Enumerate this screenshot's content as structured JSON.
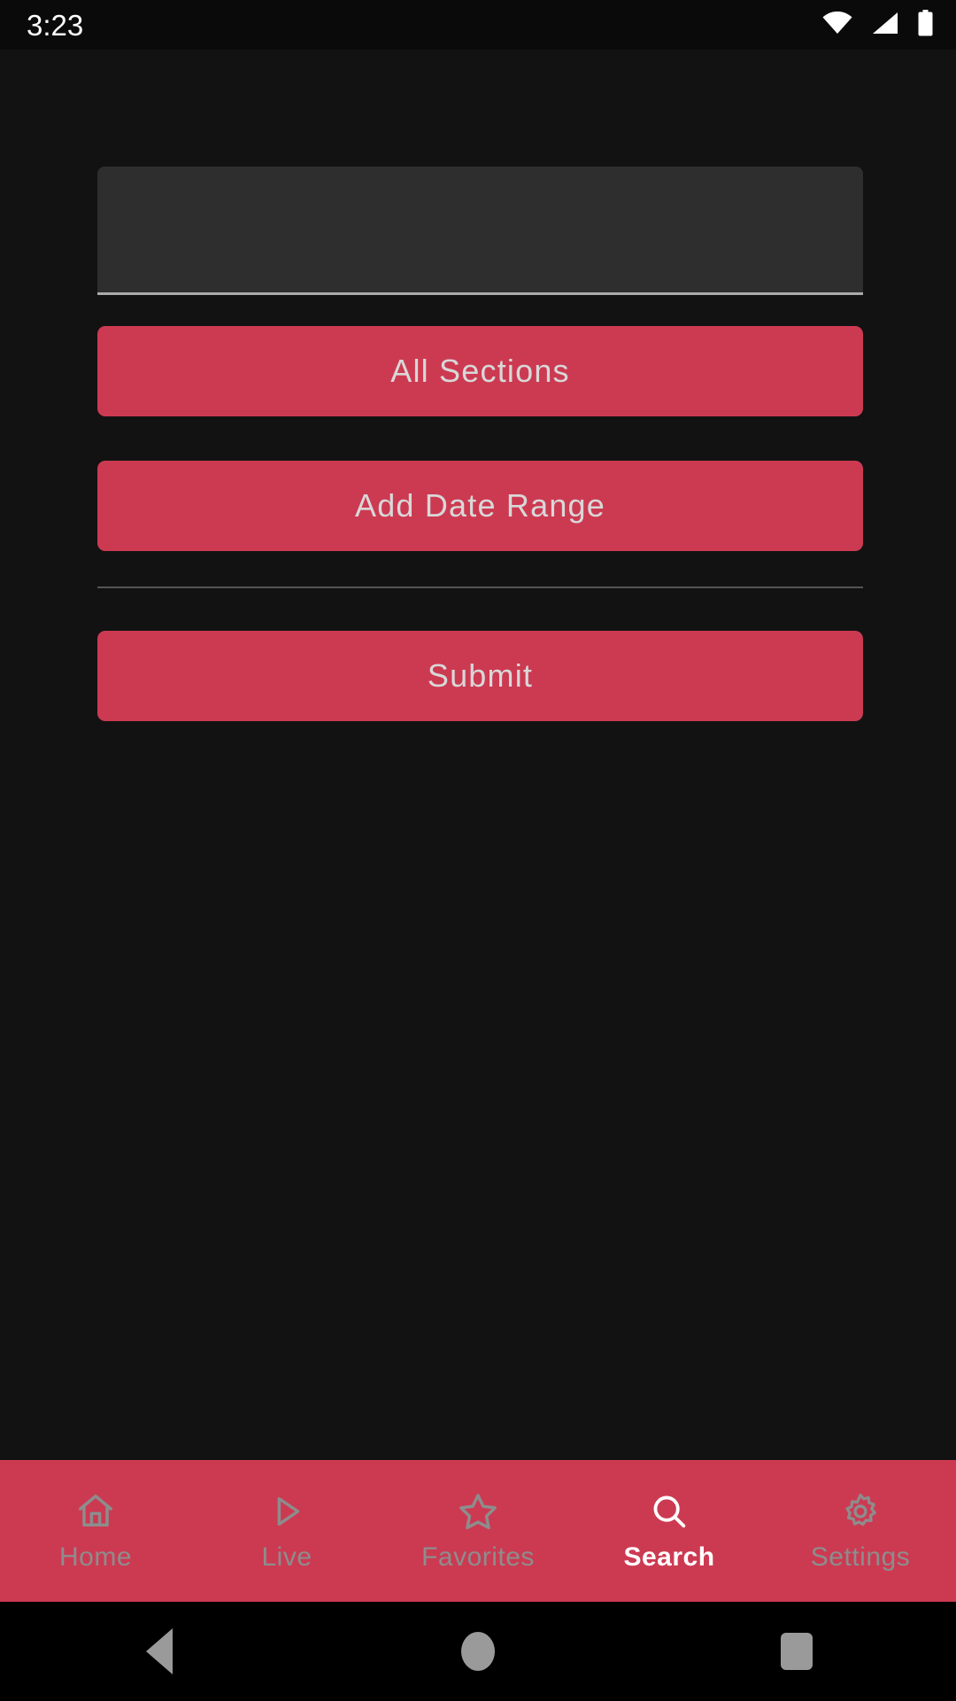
{
  "status_bar": {
    "time": "3:23",
    "icons": [
      "wifi-icon",
      "cellular-signal-icon",
      "battery-icon"
    ]
  },
  "search_form": {
    "query_input": {
      "value": "",
      "placeholder": ""
    },
    "sections_button": "All Sections",
    "date_range_button": "Add Date Range",
    "submit_button": "Submit"
  },
  "tab_bar": {
    "active": "Search",
    "items": [
      {
        "label": "Home",
        "icon": "home-icon",
        "active": false
      },
      {
        "label": "Live",
        "icon": "play-icon",
        "active": false
      },
      {
        "label": "Favorites",
        "icon": "star-icon",
        "active": false
      },
      {
        "label": "Search",
        "icon": "search-icon",
        "active": true
      },
      {
        "label": "Settings",
        "icon": "gear-icon",
        "active": false
      }
    ]
  },
  "system_nav": {
    "back": "back-button",
    "home": "home-button",
    "recents": "recents-button"
  },
  "colors": {
    "accent": "#cc3a52",
    "background": "#121212",
    "status_bar": "#0a0a0a",
    "field": "#2e2e2e",
    "field_underline": "#ababab",
    "button_text": "#d8d8d8",
    "tab_inactive": "#8d8d8d",
    "tab_active": "#ffffff",
    "divider": "#545454"
  }
}
